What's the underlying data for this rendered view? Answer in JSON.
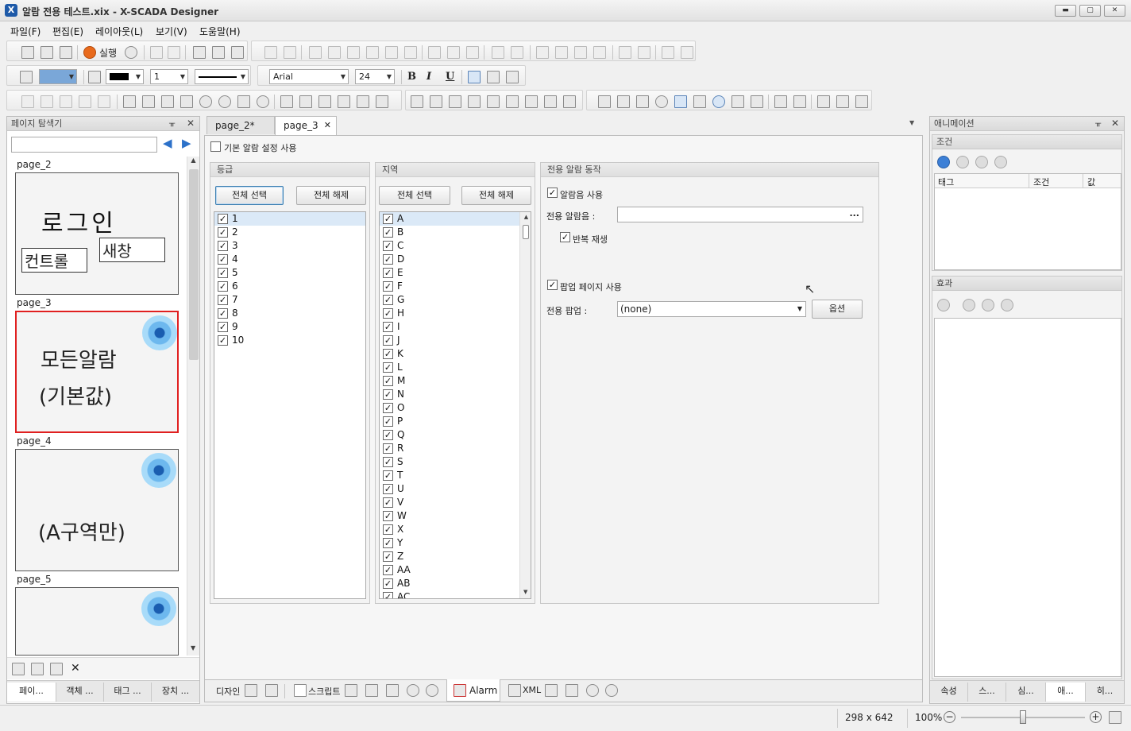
{
  "titlebar": {
    "title": "알람 전용 테스트.xix - X-SCADA Designer",
    "logo": "X",
    "min": "▬",
    "max": "▢",
    "close": "✕"
  },
  "menu": [
    "파일(F)",
    "편집(E)",
    "레이아웃(L)",
    "보기(V)",
    "도움말(H)"
  ],
  "toolbar": {
    "run_label": "실행",
    "font_name": "Arial",
    "font_size": "24",
    "line_width": "1",
    "bold": "B",
    "italic": "I",
    "underline": "U"
  },
  "left_panel": {
    "title": "페이지 탐색기",
    "pages": [
      {
        "label": "page_2",
        "text1": "로그인",
        "text2": "컨트롤",
        "text3": "새창"
      },
      {
        "label": "page_3",
        "text1": "모든알람",
        "text2": "(기본값)"
      },
      {
        "label": "page_4",
        "text1": "(A구역만)"
      },
      {
        "label": "page_5"
      }
    ],
    "bottom_tabs": [
      "페이...",
      "객체 ...",
      "태그 ...",
      "장치 ..."
    ]
  },
  "doc_tabs": [
    "page_2*",
    "page_3"
  ],
  "alarm_editor": {
    "use_default": "기본 알람 설정 사용",
    "grade": {
      "title": "등급",
      "select_all": "전체 선택",
      "deselect_all": "전체 해제",
      "items": [
        "1",
        "2",
        "3",
        "4",
        "5",
        "6",
        "7",
        "8",
        "9",
        "10"
      ]
    },
    "region": {
      "title": "지역",
      "select_all": "전체 선택",
      "deselect_all": "전체 해제",
      "items": [
        "A",
        "B",
        "C",
        "D",
        "E",
        "F",
        "G",
        "H",
        "I",
        "J",
        "K",
        "L",
        "M",
        "N",
        "O",
        "P",
        "Q",
        "R",
        "S",
        "T",
        "U",
        "V",
        "W",
        "X",
        "Y",
        "Z",
        "AA",
        "AB",
        "AC"
      ]
    },
    "dedicated": {
      "title": "전용 알람 동작",
      "use_sound": "알람음 사용",
      "sound_label": "전용 알람음 :",
      "browse": "...",
      "repeat": "반복 재생",
      "use_popup": "팝업 페이지 사용",
      "popup_label": "전용 팝업 :",
      "popup_value": "(none)",
      "option": "옵션"
    }
  },
  "bottom_doc_tabs": {
    "design": "디자인",
    "script": "스크립트",
    "alarm": "Alarm",
    "xml": "XML"
  },
  "right_panel": {
    "title": "애니메이션",
    "condition_title": "조건",
    "columns": [
      "태그",
      "조건",
      "값"
    ],
    "effect_title": "효과",
    "bottom_tabs": [
      "속성",
      "스...",
      "심...",
      "애...",
      "히..."
    ]
  },
  "statusbar": {
    "size": "298 x 642",
    "zoom": "100%",
    "minus": "−",
    "plus": "+"
  }
}
